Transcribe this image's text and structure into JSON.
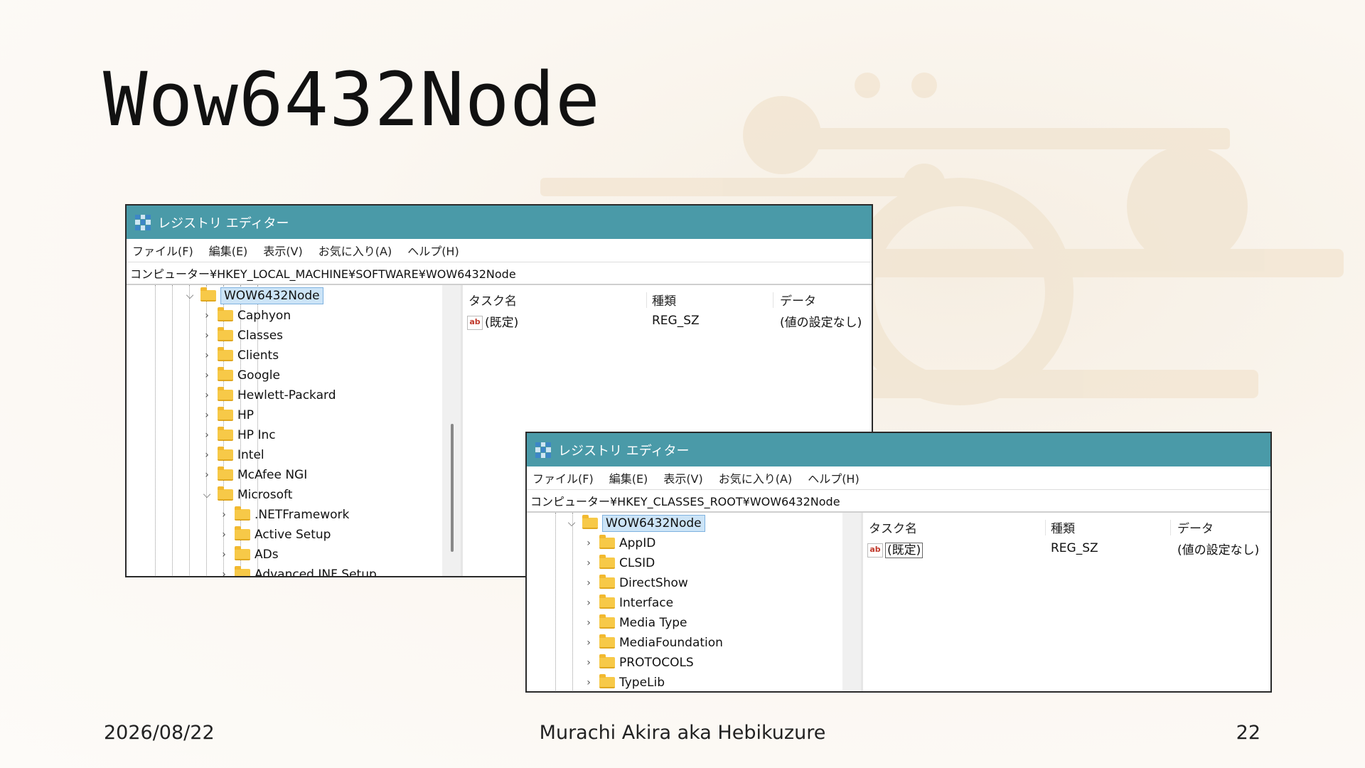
{
  "slide": {
    "title": "Wow6432Node",
    "date": "2026/08/22",
    "author": "Murachi Akira aka Hebikuzure",
    "page": "22"
  },
  "windows": [
    {
      "title": "レジストリ エディター",
      "menu": [
        "ファイル(F)",
        "編集(E)",
        "表示(V)",
        "お気に入り(A)",
        "ヘルプ(H)"
      ],
      "address": "コンピューター¥HKEY_LOCAL_MACHINE¥SOFTWARE¥WOW6432Node",
      "tree": {
        "selected": "WOW6432Node",
        "children": [
          "Caphyon",
          "Classes",
          "Clients",
          "Google",
          "Hewlett-Packard",
          "HP",
          "HP Inc",
          "Intel",
          "McAfee NGI",
          "Microsoft"
        ],
        "microsoft_children": [
          ".NETFramework",
          "Active Setup",
          "ADs",
          "Advanced INF Setup"
        ]
      },
      "list": {
        "headers": [
          "タスク名",
          "種類",
          "データ"
        ],
        "rows": [
          {
            "name": "(既定)",
            "type": "REG_SZ",
            "data": "(値の設定なし)"
          }
        ]
      }
    },
    {
      "title": "レジストリ エディター",
      "menu": [
        "ファイル(F)",
        "編集(E)",
        "表示(V)",
        "お気に入り(A)",
        "ヘルプ(H)"
      ],
      "address": "コンピューター¥HKEY_CLASSES_ROOT¥WOW6432Node",
      "tree": {
        "selected": "WOW6432Node",
        "children": [
          "AppID",
          "CLSID",
          "DirectShow",
          "Interface",
          "Media Type",
          "MediaFoundation",
          "PROTOCOLS",
          "TypeLib"
        ]
      },
      "list": {
        "headers": [
          "タスク名",
          "種類",
          "データ"
        ],
        "rows": [
          {
            "name": "(既定)",
            "type": "REG_SZ",
            "data": "(値の設定なし)"
          }
        ]
      }
    }
  ],
  "icons": {
    "app": "registry-editor-icon",
    "folder": "folder-icon",
    "value": "string-value-icon"
  },
  "colors": {
    "titlebar": "#4a9aa8",
    "selection": "#cce4f7",
    "folder": "#f7c948"
  }
}
